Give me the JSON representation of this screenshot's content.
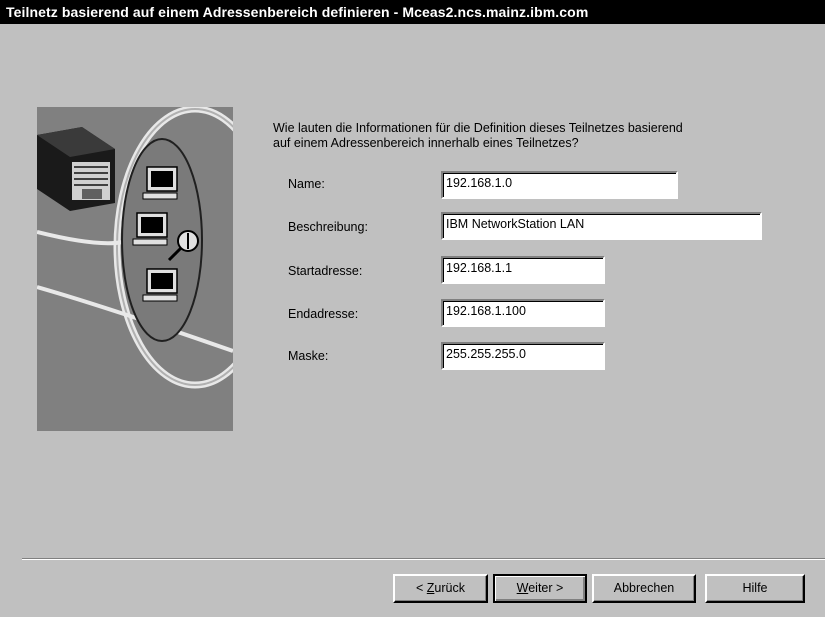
{
  "window": {
    "title": "Teilnetz basierend auf einem Adressenbereich definieren - Mceas2.ncs.mainz.ibm.com"
  },
  "prompt": {
    "line1": "Wie lauten die Informationen für die Definition dieses Teilnetzes basierend",
    "line2": "auf einem Adressenbereich innerhalb eines Teilnetzes?"
  },
  "fields": {
    "name": {
      "label": "Name:",
      "value": "192.168.1.0"
    },
    "description": {
      "label": "Beschreibung:",
      "value": "IBM NetworkStation LAN"
    },
    "start_address": {
      "label": "Startadresse:",
      "value": "192.168.1.1"
    },
    "end_address": {
      "label": "Endadresse:",
      "value": "192.168.1.100"
    },
    "mask": {
      "label": "Maske:",
      "value": "255.255.255.0"
    }
  },
  "buttons": {
    "back": {
      "prefix": "< ",
      "mnemonic": "Z",
      "rest": "urück"
    },
    "next": {
      "mnemonic": "W",
      "rest": "eiter >"
    },
    "cancel": {
      "label": "Abbrechen"
    },
    "help": {
      "label": "Hilfe"
    }
  },
  "colors": {
    "title_bar": "#000000",
    "dialog_face": "#c0c0c0",
    "illustration_bg": "#808080"
  },
  "illustration": {
    "icons": [
      "server-icon",
      "network-station-icon",
      "magnifier-icon"
    ]
  }
}
